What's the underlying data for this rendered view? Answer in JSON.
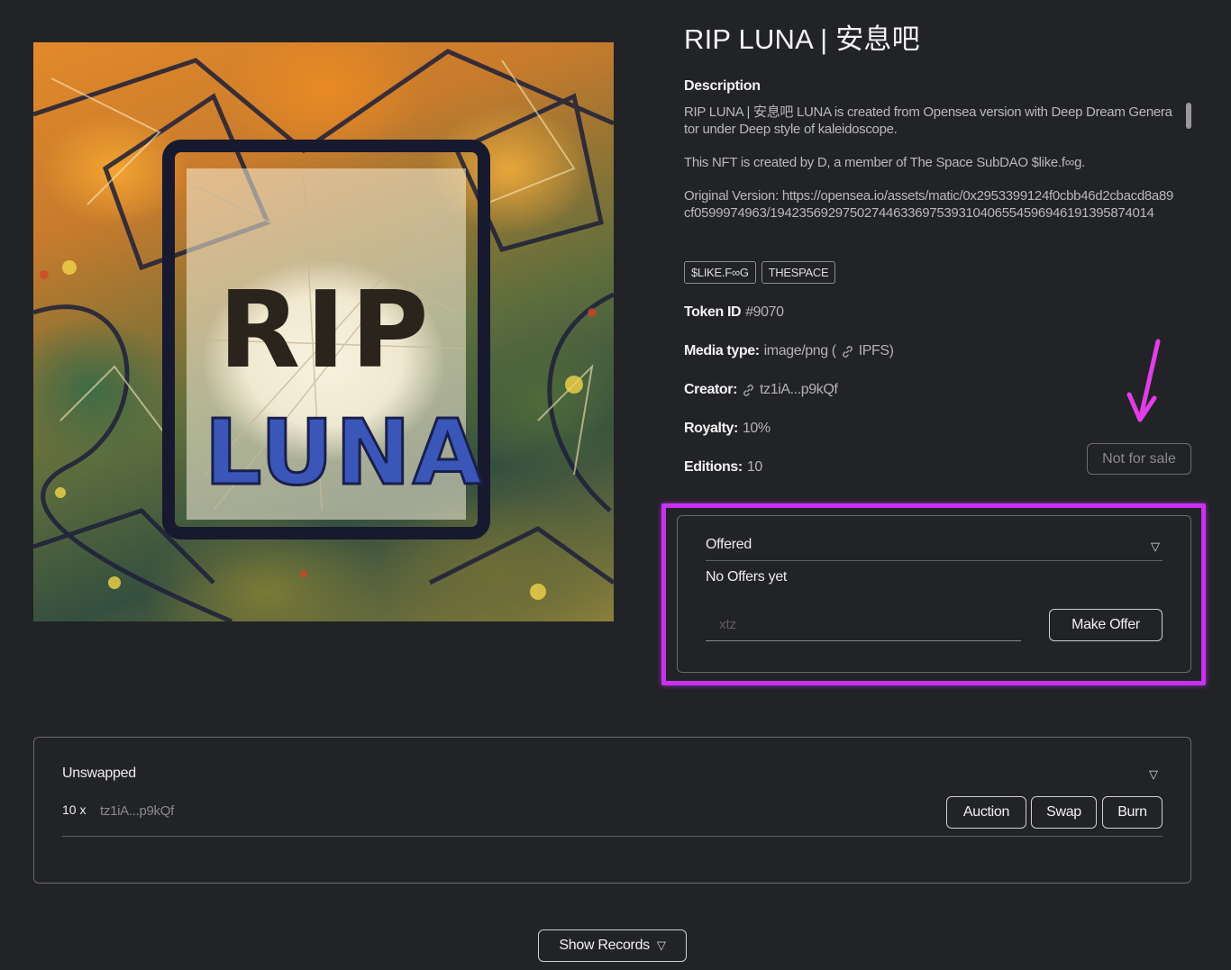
{
  "artwork": {
    "alt": "RIP LUNA artwork",
    "overlay_text_top": "RIP",
    "overlay_text_bottom": "LUNA"
  },
  "title": "RIP LUNA | 安息吧",
  "description": {
    "heading": "Description",
    "paragraphs": [
      "RIP LUNA | 安息吧 LUNA is created from Opensea version with Deep Dream Generator under Deep style of kaleidoscope.",
      "This NFT is created by D,  a member of The Space SubDAO $like.f∞g.",
      "Original Version: https://opensea.io/assets/matic/0x2953399124f0cbb46d2cbacd8a89cf0599974963/19423569297502744633697539310406554596946191395874014"
    ]
  },
  "tags": [
    "$LIKE.F∞G",
    "THESPACE"
  ],
  "meta": {
    "token_label": "Token ID",
    "token_value": "#9070",
    "media_label": "Media type:",
    "media_value": "image/png (",
    "media_link": "IPFS)",
    "creator_label": "Creator:",
    "creator_value": "tz1iA...p9kQf",
    "royalty_label": "Royalty:",
    "royalty_value": "10%",
    "editions_label": "Editions:",
    "editions_value": "10"
  },
  "sale_status": "Not for sale",
  "offers": {
    "heading": "Offered",
    "empty_text": "No Offers yet",
    "input_placeholder": "xtz",
    "button_label": "Make Offer"
  },
  "unswapped": {
    "heading": "Unswapped",
    "count": "10 x",
    "owner": "tz1iA...p9kQf",
    "actions": [
      "Auction",
      "Swap",
      "Burn"
    ]
  },
  "records_button": "Show Records",
  "colors": {
    "background": "#222326",
    "highlight": "#c832f2",
    "annotation_arrow": "#e33ce8"
  },
  "icons": {
    "caret": "triangle-down-icon",
    "link": "link-icon",
    "arrow": "annotation-arrow-icon"
  }
}
